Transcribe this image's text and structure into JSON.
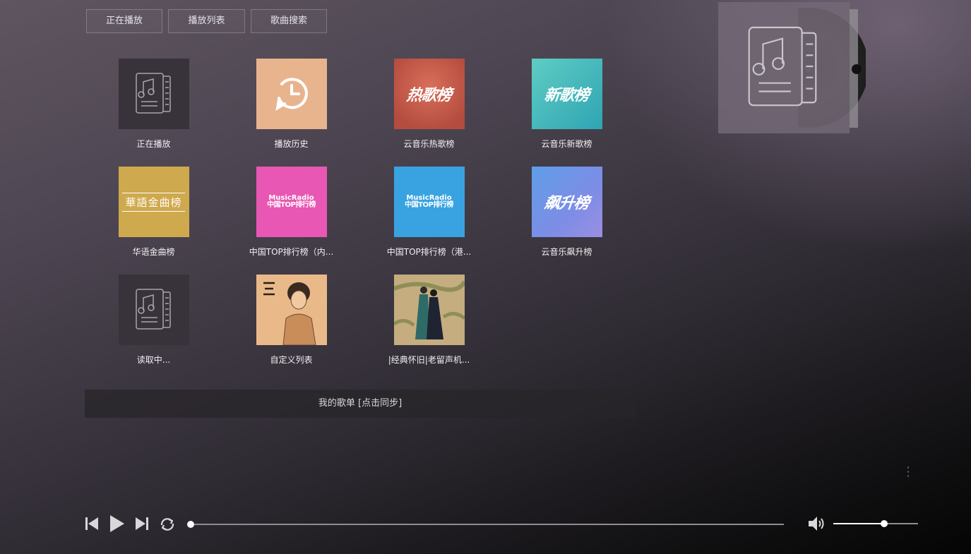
{
  "nav": {
    "tabs": [
      "正在播放",
      "播放列表",
      "歌曲搜索"
    ]
  },
  "grid": {
    "tiles": [
      {
        "label": "正在播放",
        "cover": "music-doc-icon"
      },
      {
        "label": "播放历史",
        "cover": "history-clock-icon"
      },
      {
        "label": "云音乐热歌榜",
        "cover_text": "热歌榜"
      },
      {
        "label": "云音乐新歌榜",
        "cover_text": "新歌榜"
      },
      {
        "label": "华语金曲榜",
        "cover_text": "華語金曲榜"
      },
      {
        "label": "中国TOP排行榜（内...",
        "cover_text_a": "MusicRadio",
        "cover_text_b": "中国TOP排行榜"
      },
      {
        "label": "中国TOP排行榜（港...",
        "cover_text_a": "MusicRadio",
        "cover_text_b": "中国TOP排行榜"
      },
      {
        "label": "云音乐飙升榜",
        "cover_text": "飙升榜"
      },
      {
        "label": "读取中...",
        "cover": "music-doc-icon"
      },
      {
        "label": "自定义列表",
        "cover": "album-photo"
      },
      {
        "label": "|经典怀旧|老留声机...",
        "cover": "album-art"
      }
    ]
  },
  "sync_bar": {
    "label": "我的歌单 [点击同步]"
  },
  "now_playing": {
    "art": "music-doc-icon"
  },
  "player": {
    "progress": 0.0,
    "volume": 0.6,
    "buttons": [
      "previous-icon",
      "play-icon",
      "next-icon",
      "repeat-icon",
      "volume-icon"
    ]
  },
  "colors": {
    "hot": "#b44c3f",
    "new": "#2fa4b3",
    "gold": "#cfa94e",
    "pink": "#e857b3",
    "blue": "#38a3e0",
    "soar": "#7d8de6",
    "history": "#e8b48e"
  }
}
